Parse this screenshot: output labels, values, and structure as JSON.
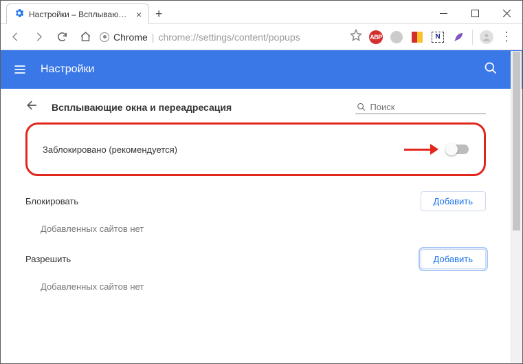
{
  "window": {
    "tab_title": "Настройки – Всплывающие окн"
  },
  "addressbar": {
    "host": "Chrome",
    "path": "chrome://settings/content/popups",
    "extensions": {
      "abp": "ABP",
      "nbox": "N"
    }
  },
  "page": {
    "header_title": "Настройки"
  },
  "section": {
    "title": "Всплывающие окна и переадресация",
    "search_placeholder": "Поиск"
  },
  "main_switch": {
    "label": "Заблокировано (рекомендуется)",
    "enabled": false
  },
  "block_section": {
    "title": "Блокировать",
    "add_label": "Добавить",
    "empty": "Добавленных сайтов нет"
  },
  "allow_section": {
    "title": "Разрешить",
    "add_label": "Добавить",
    "empty": "Добавленных сайтов нет"
  }
}
